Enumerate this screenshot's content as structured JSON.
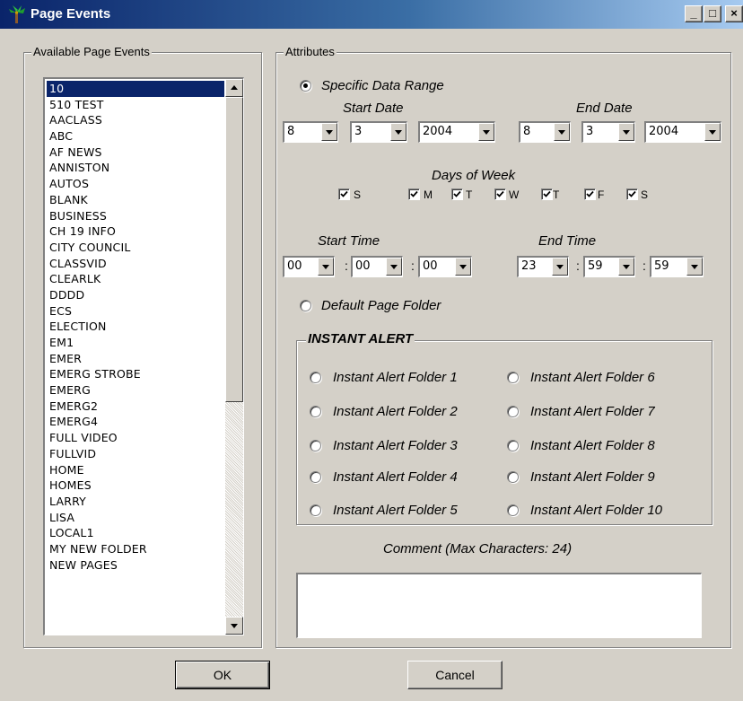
{
  "window": {
    "title": "Page Events",
    "minimize": "_",
    "maximize": "□",
    "close": "×"
  },
  "available": {
    "group_label": "Available Page Events",
    "items": [
      "10",
      "510 TEST",
      "AACLASS",
      "ABC",
      "AF NEWS",
      "ANNISTON",
      "AUTOS",
      "BLANK",
      "BUSINESS",
      "CH 19 INFO",
      "CITY COUNCIL",
      "CLASSVID",
      "CLEARLK",
      "DDDD",
      "ECS",
      "ELECTION",
      "EM1",
      "EMER",
      "EMERG STROBE",
      "EMERG",
      "EMERG2",
      "EMERG4",
      "FULL VIDEO",
      "FULLVID",
      "HOME",
      "HOMES",
      "LARRY",
      "LISA",
      "LOCAL1",
      "MY NEW FOLDER",
      "NEW PAGES"
    ],
    "selected_index": 0
  },
  "attributes": {
    "group_label": "Attributes",
    "specific_range_label": "Specific Data Range",
    "specific_range_selected": true,
    "start_date_label": "Start Date",
    "end_date_label": "End Date",
    "start_date": {
      "month": "8",
      "day": "3",
      "year": "2004"
    },
    "end_date": {
      "month": "8",
      "day": "3",
      "year": "2004"
    },
    "days_label": "Days of  Week",
    "days": [
      {
        "label": "S",
        "checked": true
      },
      {
        "label": "M",
        "checked": true
      },
      {
        "label": "T",
        "checked": true
      },
      {
        "label": "W",
        "checked": true
      },
      {
        "label": "T",
        "checked": true
      },
      {
        "label": "F",
        "checked": true
      },
      {
        "label": "S",
        "checked": true
      }
    ],
    "start_time_label": "Start Time",
    "end_time_label": "End Time",
    "start_time": {
      "hour": "00",
      "minute": "00",
      "second": "00"
    },
    "end_time": {
      "hour": "23",
      "minute": "59",
      "second": "59"
    },
    "time_separator": ":",
    "default_folder_label": "Default Page Folder",
    "instant_alert": {
      "group_label": "INSTANT ALERT",
      "folders": [
        "Instant Alert Folder 1",
        "Instant Alert Folder 2",
        "Instant Alert Folder 3",
        "Instant Alert Folder 4",
        "Instant Alert Folder 5",
        "Instant Alert Folder 6",
        "Instant Alert Folder 7",
        "Instant Alert Folder 8",
        "Instant Alert Folder 9",
        "Instant Alert Folder 10"
      ]
    },
    "comment_label": "Comment (Max Characters: 24)",
    "comment_value": ""
  },
  "buttons": {
    "ok": "OK",
    "cancel": "Cancel"
  }
}
